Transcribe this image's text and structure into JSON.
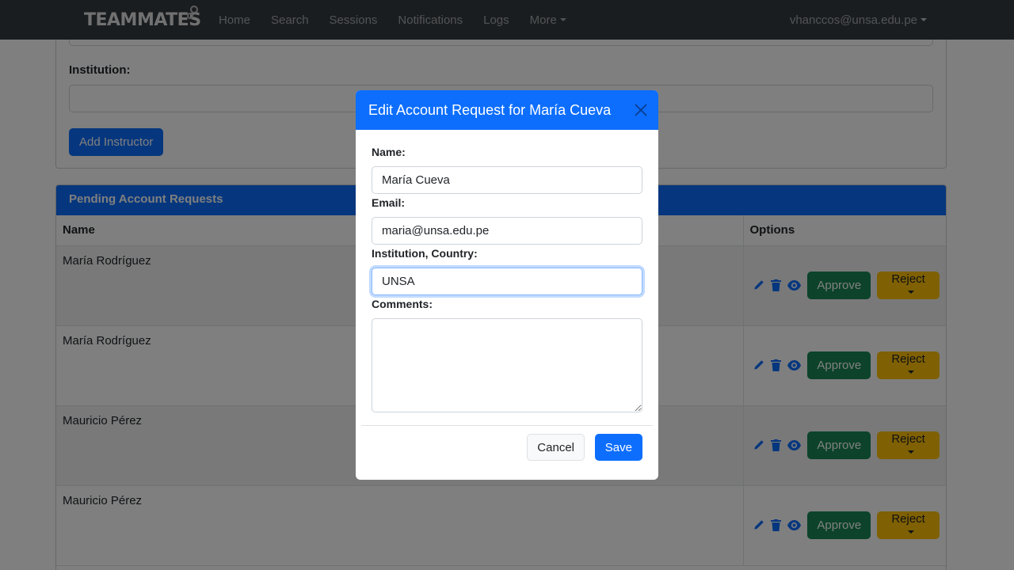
{
  "navbar": {
    "brand": "TEAMMATES",
    "links": [
      "Home",
      "Search",
      "Sessions",
      "Notifications",
      "Logs",
      "More"
    ],
    "user": "vhanccos@unsa.edu.pe"
  },
  "add_instructor": {
    "institution_label": "Institution:",
    "institution_value": "",
    "button": "Add Instructor"
  },
  "pending": {
    "title": "Pending Account Requests",
    "columns": {
      "name": "Name",
      "options": "Options"
    },
    "rows": [
      {
        "name": "María Rodríguez"
      },
      {
        "name": "María Rodríguez"
      },
      {
        "name": "Mauricio Pérez"
      },
      {
        "name": "Mauricio Pérez"
      }
    ],
    "approve_label": "Approve",
    "reject_label": "Reject",
    "icons": [
      "pencil-icon",
      "trash-icon",
      "eye-icon"
    ]
  },
  "modal": {
    "title": "Edit Account Request for María Cueva",
    "name_label": "Name:",
    "name_value": "María Cueva",
    "email_label": "Email:",
    "email_value": "maria@unsa.edu.pe",
    "institution_label": "Institution, Country:",
    "institution_value": "UNSA",
    "comments_label": "Comments:",
    "comments_value": "",
    "cancel": "Cancel",
    "save": "Save"
  },
  "colors": {
    "primary": "#0d6efd",
    "success": "#198754",
    "warning": "#ffc107",
    "navbar": "#343a40"
  }
}
